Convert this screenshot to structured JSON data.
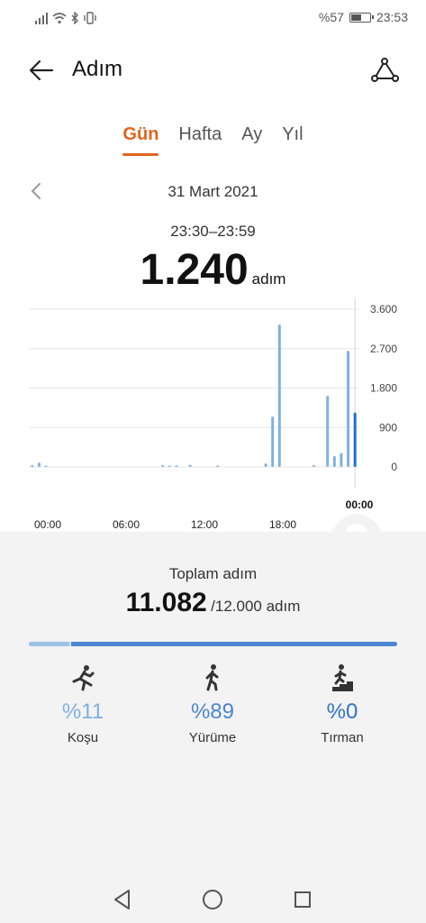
{
  "status_bar": {
    "battery_text": "%57",
    "battery_level": 0.57,
    "time": "23:53"
  },
  "header": {
    "title": "Adım",
    "back_icon": "arrow-left-icon",
    "route_icon": "route-icon"
  },
  "tabs": [
    {
      "label": "Gün",
      "active": true
    },
    {
      "label": "Hafta",
      "active": false
    },
    {
      "label": "Ay",
      "active": false
    },
    {
      "label": "Yıl",
      "active": false
    }
  ],
  "date": {
    "label": "31 Mart 2021",
    "prev_icon": "chevron-left-icon"
  },
  "selection": {
    "time_range": "23:30–23:59",
    "value": "1.240",
    "unit": "adım"
  },
  "chart_data": {
    "type": "bar",
    "x_ticks": [
      "00:00",
      "06:00",
      "12:00",
      "18:00"
    ],
    "selected_tick": "00:00",
    "y_ticks": [
      "3.600",
      "2.700",
      "1.800",
      "900",
      "0"
    ],
    "ylim": [
      0,
      3600
    ],
    "grid": true,
    "bar_color": "#7fb0e2",
    "selected_bar_color": "#1f6fd1",
    "x_unit": "half-hour slot of day (0 = 00:00)",
    "values": [
      {
        "x": 1,
        "y": 40
      },
      {
        "x": 2,
        "y": 100
      },
      {
        "x": 3,
        "y": 30
      },
      {
        "x": 20,
        "y": 40
      },
      {
        "x": 21,
        "y": 20
      },
      {
        "x": 22,
        "y": 30
      },
      {
        "x": 24,
        "y": 50
      },
      {
        "x": 28,
        "y": 30
      },
      {
        "x": 35,
        "y": 80
      },
      {
        "x": 36,
        "y": 1150
      },
      {
        "x": 37,
        "y": 3250
      },
      {
        "x": 42,
        "y": 40
      },
      {
        "x": 44,
        "y": 1620
      },
      {
        "x": 45,
        "y": 250
      },
      {
        "x": 46,
        "y": 320
      },
      {
        "x": 47,
        "y": 2650
      },
      {
        "x": 48,
        "y": 1240,
        "selected": true
      }
    ]
  },
  "total": {
    "label": "Toplam adım",
    "value": "11.082",
    "goal": "/12.000 adım"
  },
  "progress": {
    "run_fraction": 0.11,
    "walk_fraction": 0.89,
    "colors": {
      "run": "#9fc0e8",
      "walk": "#4d86d2"
    }
  },
  "activities": [
    {
      "icon": "running-icon",
      "percent": "%11",
      "label": "Koşu",
      "color": "#7fb0e2"
    },
    {
      "icon": "walking-icon",
      "percent": "%89",
      "label": "Yürüme",
      "color": "#4d86d2"
    },
    {
      "icon": "climbing-icon",
      "percent": "%0",
      "label": "Tırman",
      "color": "#2f74c8"
    }
  ],
  "nav": {
    "back_icon": "triangle-back-icon",
    "home_icon": "circle-home-icon",
    "recents_icon": "square-recents-icon"
  }
}
